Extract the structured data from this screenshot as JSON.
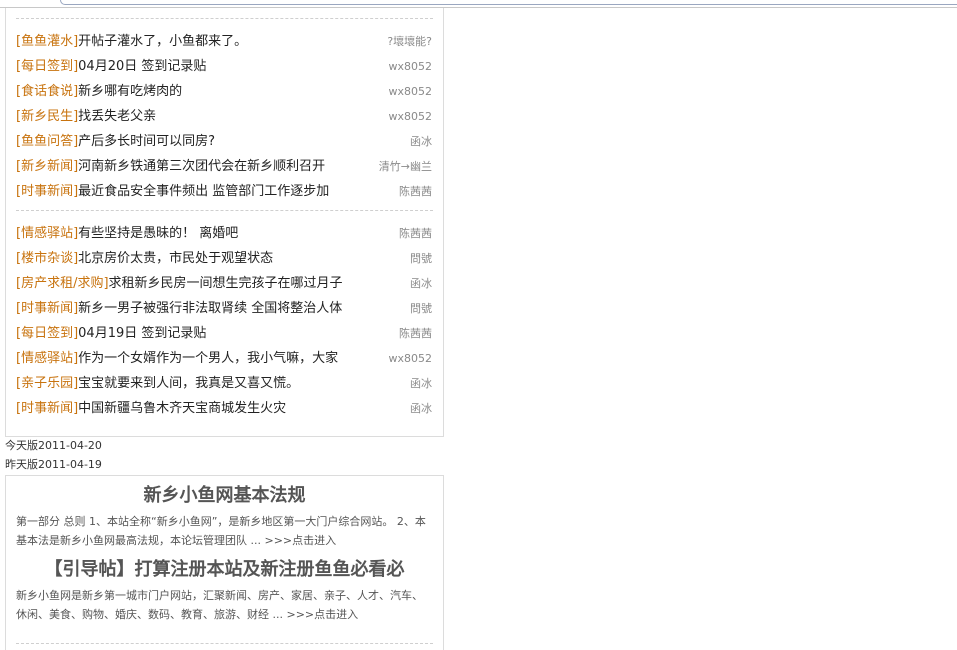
{
  "list_groups": [
    [
      {
        "category": "[鱼鱼灌水]",
        "title": "开帖子灌水了，小鱼都来了。",
        "author": "?壞壞能?"
      },
      {
        "category": "[每日签到]",
        "title": "04月20日  签到记录贴",
        "author": "wx8052"
      },
      {
        "category": "[食话食说]",
        "title": "新乡哪有吃烤肉的",
        "author": "wx8052"
      },
      {
        "category": "[新乡民生]",
        "title": "找丢失老父亲",
        "author": "wx8052"
      },
      {
        "category": "[鱼鱼问答]",
        "title": "产后多长时间可以同房?",
        "author": "函冰"
      },
      {
        "category": "[新乡新闻]",
        "title": "河南新乡铁通第三次团代会在新乡顺利召开",
        "author": "清竹→幽兰"
      },
      {
        "category": "[时事新闻]",
        "title": "最近食品安全事件频出  监管部门工作逐步加",
        "author": "陈茜茜"
      }
    ],
    [
      {
        "category": "[情感驿站]",
        "title": "有些坚持是愚昧的！ 离婚吧",
        "author": "陈茜茜"
      },
      {
        "category": "[楼市杂谈]",
        "title": "北京房价太贵，市民处于观望状态",
        "author": "問號"
      },
      {
        "category": "[房产求租/求购]",
        "title": "求租新乡民房一间想生完孩子在哪过月子",
        "author": "函冰"
      },
      {
        "category": "[时事新闻]",
        "title": "新乡一男子被强行非法取肾续  全国将整治人体",
        "author": "問號"
      },
      {
        "category": "[每日签到]",
        "title": "04月19日  签到记录贴",
        "author": "陈茜茜"
      },
      {
        "category": "[情感驿站]",
        "title": "作为一个女婿作为一个男人，我小气嘛，大家",
        "author": "wx8052"
      },
      {
        "category": "[亲子乐园]",
        "title": "宝宝就要来到人间，我真是又喜又慌。",
        "author": "函冰"
      },
      {
        "category": "[时事新闻]",
        "title": "中国新疆乌鲁木齐天宝商城发生火灾",
        "author": "函冰"
      }
    ]
  ],
  "editions": {
    "today": "今天版2011-04-20",
    "yesterday": "昨天版2011-04-19"
  },
  "notices": [
    {
      "title": "新乡小鱼网基本法规",
      "excerpt": "第一部分  总则  1、本站全称“新乡小鱼网”，是新乡地区第一大门户综合网站。 2、本基本法是新乡小鱼网最高法规，本论坛管理团队 ... ",
      "more": ">>>点击进入"
    },
    {
      "title": "【引导帖】打算注册本站及新注册鱼鱼必看必",
      "excerpt": "新乡小鱼网是新乡第一城市门户网站，汇聚新闻、房产、家居、亲子、人才、汽车、休闲、美食、购物、婚庆、数码、教育、旅游、财经 ... ",
      "more": ">>>点击进入"
    }
  ]
}
